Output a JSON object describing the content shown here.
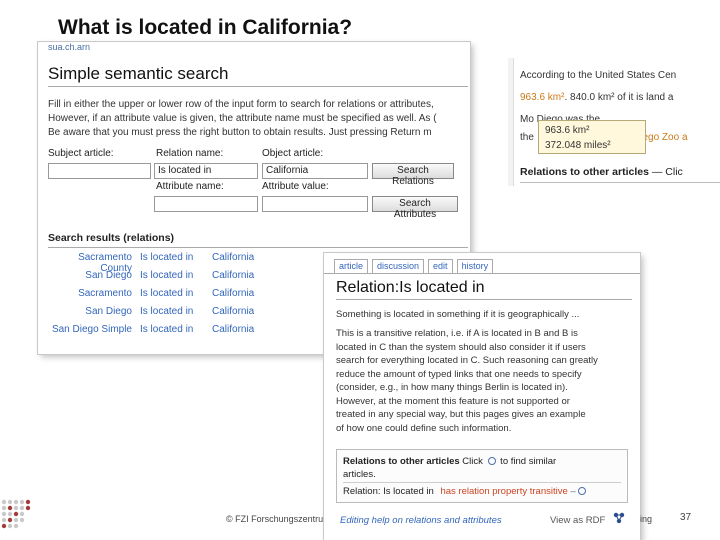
{
  "slide": {
    "title": "What is located in California?",
    "footer_left": "© FZI Forschungszentru",
    "footer_right": "ing",
    "page_number": "37",
    "accent_color": "#8a1d1d"
  },
  "search_shot": {
    "breadcrumb": "sua.ch.arn",
    "heading": "Simple semantic search",
    "intro": [
      "Fill in either the upper or lower row of the input form to search for relations or attributes,",
      "However, if an attribute value is given, the attribute name must be specified as well. As (",
      "Be aware that you must press the right button to obtain results. Just pressing Return m"
    ],
    "subject_label": "Subject article:",
    "relation_label": "Relation name:",
    "object_label": "Object article:",
    "attribute_label": "Attribute name:",
    "attribute_value_label": "Attribute value:",
    "subject_value": "",
    "relation_value": "Is located in",
    "object_value": "California",
    "attribute_name_value": "",
    "attribute_value_value": "",
    "search_relations_button": "Search Relations",
    "search_attributes_button": "Search Attributes",
    "results_heading": "Search results (relations)",
    "results": [
      {
        "subject": "Sacramento County",
        "relation": "Is located in",
        "object": "California"
      },
      {
        "subject": "San Diego",
        "relation": "Is located in",
        "object": "California"
      },
      {
        "subject": "Sacramento",
        "relation": "Is located in",
        "object": "California"
      },
      {
        "subject": "San Diego",
        "relation": "Is located in",
        "object": "California"
      },
      {
        "subject": "San Diego Simple",
        "relation": "Is located in",
        "object": "California"
      }
    ]
  },
  "wiki_shot": {
    "line1": "According to the United States Cen",
    "line2_a": "963.6 km²",
    "line2_b": ". 840.0 km² of it is land a",
    "line3": "Mo        Diego was the",
    "line4_a": "the",
    "line4_b": "n Diego Zoo a",
    "tooltip_line1": "963.6 km²",
    "tooltip_line2": "372.048 miles²",
    "relations_heading": "Relations to other articles",
    "relations_suffix": " — Clic"
  },
  "relation_shot": {
    "tabs": [
      "article",
      "discussion",
      "edit",
      "history"
    ],
    "heading": "Relation:Is located in",
    "first_line": "Something is located in something if it is geographically ...",
    "paragraph": [
      "This is a transitive relation, i.e. if A is located in B and B is",
      "located in C than the system should also consider it if users",
      "search for everything located in C. Such reasoning can greatly",
      "reduce the amount of typed links that one needs to specify",
      "(consider, e.g., in how many things Berlin is located in).",
      "However, at the moment this feature is not supported or",
      "treated in any special way, but this pages gives an example",
      "of how one could define such information."
    ],
    "box_heading": "Relations to other articles",
    "box_click": " Click ",
    "box_findsimilar": " to find similar",
    "box_articles": "articles.",
    "box_row_label": "Relation: Is located in",
    "box_row_value": "has relation property transitive",
    "footer_link": "Editing help on relations and attributes",
    "footer_view": "View as RDF"
  }
}
